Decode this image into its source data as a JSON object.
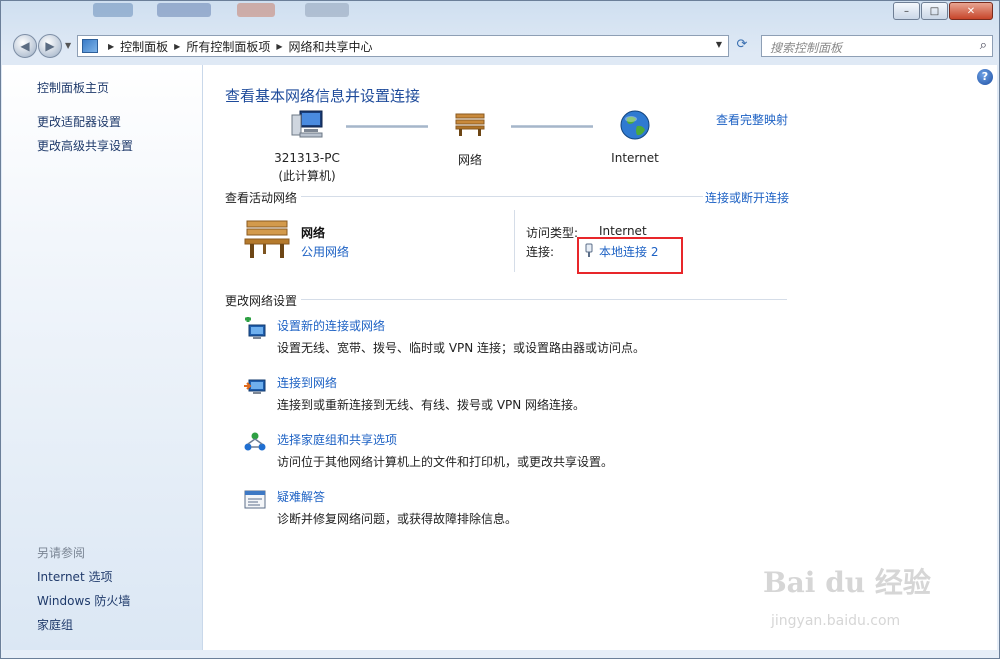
{
  "window": {
    "minimize_label": "–",
    "maximize_label": "□",
    "close_label": "✕"
  },
  "address_bar": {
    "crumbs": [
      "控制面板",
      "所有控制面板项",
      "网络和共享中心"
    ],
    "search_placeholder": "搜索控制面板"
  },
  "sidebar": {
    "items": [
      {
        "label": "控制面板主页"
      },
      {
        "label": "更改适配器设置"
      },
      {
        "label": "更改高级共享设置"
      }
    ],
    "see_also_label": "另请参阅",
    "see_also": [
      {
        "label": "Internet 选项"
      },
      {
        "label": "Windows 防火墙"
      },
      {
        "label": "家庭组"
      }
    ]
  },
  "main": {
    "heading": "查看基本网络信息并设置连接",
    "full_map_link": "查看完整映射",
    "map": {
      "computer_name": "321313-PC",
      "computer_sub": "(此计算机)",
      "network_label": "网络",
      "internet_label": "Internet"
    },
    "active_section": {
      "label": "查看活动网络",
      "connect_link": "连接或断开连接",
      "network_name": "网络",
      "network_type": "公用网络",
      "access_type_label": "访问类型:",
      "access_type_value": "Internet",
      "connections_label": "连接:",
      "connection_link": "本地连接 2"
    },
    "change_section": {
      "label": "更改网络设置",
      "tasks": [
        {
          "title": "设置新的连接或网络",
          "desc": "设置无线、宽带、拨号、临时或 VPN 连接；或设置路由器或访问点。",
          "icon": "new-connection-icon"
        },
        {
          "title": "连接到网络",
          "desc": "连接到或重新连接到无线、有线、拨号或 VPN 网络连接。",
          "icon": "connect-network-icon"
        },
        {
          "title": "选择家庭组和共享选项",
          "desc": "访问位于其他网络计算机上的文件和打印机，或更改共享设置。",
          "icon": "homegroup-icon"
        },
        {
          "title": "疑难解答",
          "desc": "诊断并修复网络问题，或获得故障排除信息。",
          "icon": "troubleshoot-icon"
        }
      ]
    },
    "help_label": "?"
  },
  "watermark": {
    "text": "Bai du 经验",
    "sub": "jingyan.baidu.com"
  },
  "colors": {
    "link": "#1e62c4",
    "heading": "#1e4b9b",
    "highlight_box": "#e8262a"
  }
}
